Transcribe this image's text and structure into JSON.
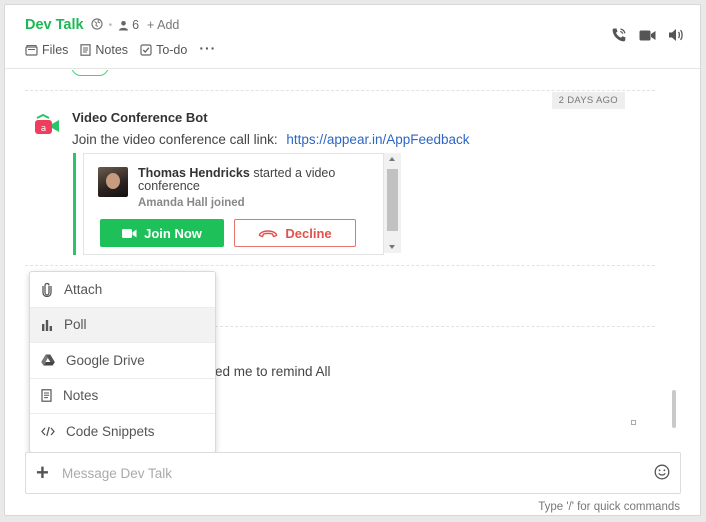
{
  "header": {
    "channel_name": "Dev Talk",
    "member_count": "6",
    "add_label": "+ Add",
    "tabs": [
      {
        "label": "Files",
        "icon": "files-icon"
      },
      {
        "label": "Notes",
        "icon": "notes-icon"
      },
      {
        "label": "To-do",
        "icon": "todo-icon"
      }
    ],
    "more_label": "···"
  },
  "messages": {
    "date_badge": "2 DAYS AGO",
    "bot": {
      "name": "Video Conference Bot",
      "text": "Join the video conference call link:",
      "link": "https://appear.in/AppFeedback"
    },
    "call": {
      "caller": "Thomas Hendricks",
      "action": "started a video conference",
      "joined": "Amanda Hall joined",
      "join_label": "Join Now",
      "decline_label": "Decline"
    },
    "remind_text": "ed me to remind All"
  },
  "attach_menu": {
    "items": [
      {
        "label": "Attach",
        "icon": "paperclip-icon"
      },
      {
        "label": "Poll",
        "icon": "poll-icon"
      },
      {
        "label": "Google Drive",
        "icon": "google-drive-icon"
      },
      {
        "label": "Notes",
        "icon": "notes-icon"
      },
      {
        "label": "Code Snippets",
        "icon": "code-icon"
      }
    ],
    "hovered": "Poll"
  },
  "composer": {
    "placeholder": "Message Dev Talk",
    "value": "",
    "hint": "Type '/' for quick commands"
  },
  "colors": {
    "brand_green": "#1db954",
    "join_green": "#1ec05a",
    "decline_red": "#e0534d",
    "link_blue": "#2e66c4"
  }
}
